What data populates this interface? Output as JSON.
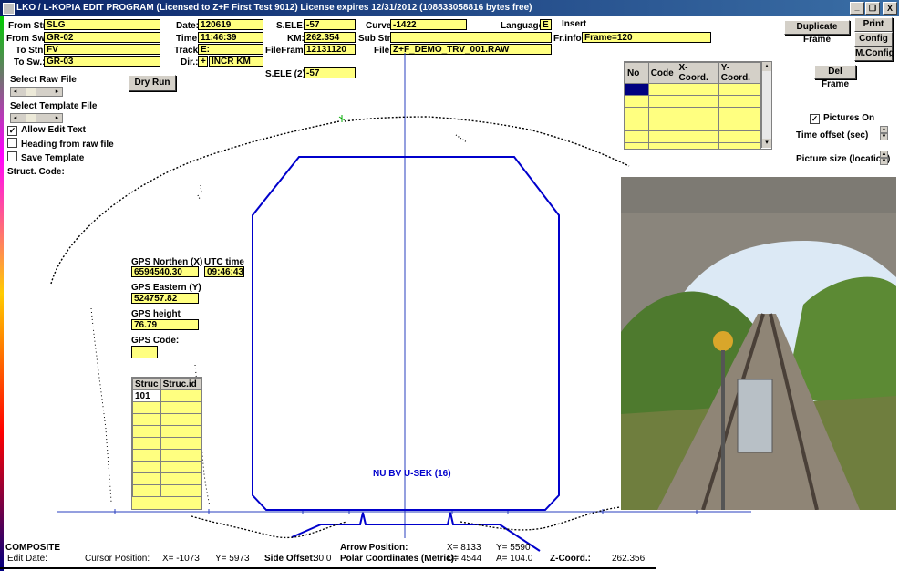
{
  "titlebar": {
    "title": "LKO / L-KOPIA EDIT PROGRAM   (Licensed to Z+F First Test 9012)   License expires 12/31/2012   (108833058816 bytes free)",
    "btn_min": "_",
    "btn_max": "❐",
    "btn_close": "X"
  },
  "header": {
    "from_stn_label": "From Stn:",
    "from_stn": "SLG",
    "from_sw_label": "From Sw.:",
    "from_sw": "GR-02",
    "to_stn_label": "To Stn:",
    "to_stn": "FV",
    "to_sw_label": "To Sw.:",
    "to_sw": "GR-03",
    "date_label": "Date:",
    "date": "120619",
    "time_label": "Time:",
    "time": "11:46:39",
    "track_label": "Track:",
    "track": "E:",
    "dir_label": "Dir.:",
    "dir_sign": "+",
    "dir": "INCR KM",
    "sele_label": "S.ELE:",
    "sele": "-57",
    "km_label": "KM:",
    "km": "262.354",
    "fileframe_label": "FileFrame:",
    "fileframe": "12131120",
    "sele2_label": "S.ELE (2):",
    "sele2": "-57",
    "curve_label": "Curve:",
    "curve": "-1422",
    "substn_label": "Sub Stn:",
    "substn": "",
    "file_label": "File:",
    "file": "Z+F_DEMO_TRV_001.RAW",
    "language_label": "Language:",
    "language": "E",
    "insert_label": "Insert",
    "frinfo_label": "Fr.info:",
    "frinfo": "Frame=120"
  },
  "buttons": {
    "duplicate": "Duplicate Frame",
    "print": "Print",
    "config": "Config",
    "mconfig": "M.Config",
    "del_frame": "Del Frame",
    "dry_run": "Dry Run"
  },
  "left_panel": {
    "select_raw": "Select Raw File",
    "select_template": "Select Template File",
    "allow_edit": "Allow Edit Text",
    "heading_raw": "Heading from raw file",
    "save_template": "Save Template",
    "struct_code": "Struct. Code:"
  },
  "coord_table": {
    "headers": [
      "No",
      "Code",
      "X-Coord.",
      "Y-Coord."
    ],
    "rows": [
      [
        "",
        "",
        "",
        ""
      ],
      [
        "",
        "",
        "",
        ""
      ],
      [
        "",
        "",
        "",
        ""
      ],
      [
        "",
        "",
        "",
        ""
      ],
      [
        "",
        "",
        "",
        ""
      ],
      [
        "",
        "",
        "",
        ""
      ]
    ]
  },
  "right_panel": {
    "pictures_on": "Pictures On",
    "time_offset": "Time offset (sec)",
    "picture_size": "Picture size (location)"
  },
  "gps": {
    "northen_label": "GPS Northen (X)",
    "northen": "6594540.30",
    "utc_label": "UTC time",
    "utc": "09:46:43.",
    "eastern_label": "GPS Eastern  (Y)",
    "eastern": "524757.82",
    "height_label": "GPS height",
    "height": "76.79",
    "code_label": "GPS Code:",
    "code": ""
  },
  "struc_table": {
    "headers": [
      "Struc",
      "Struc.id"
    ],
    "rows": [
      [
        "101",
        ""
      ],
      [
        "",
        ""
      ],
      [
        "",
        ""
      ],
      [
        "",
        ""
      ],
      [
        "",
        ""
      ],
      [
        "",
        ""
      ],
      [
        "",
        ""
      ],
      [
        "",
        ""
      ],
      [
        "",
        ""
      ]
    ]
  },
  "profile": {
    "label": "NU BV U-SEK  (16)",
    "profile_color": "#0000cc"
  },
  "status": {
    "composite": "COMPOSITE",
    "edit_date": "Edit Date:",
    "cursor_label": "Cursor Position:",
    "cursor_x": "X=  -1073",
    "cursor_y": "Y=  5973",
    "side_offset_label": "Side Offset:",
    "side_offset": "30.0",
    "arrow_label": "Arrow Position:",
    "arrow_x": "X=  8133",
    "arrow_y": "Y=  5590",
    "polar_label": "Polar Coordinates (Metric):",
    "polar_d": "D=  4544",
    "polar_a": "A=  104.0",
    "zcoord_label": "Z-Coord.:",
    "zcoord": "262.356"
  }
}
